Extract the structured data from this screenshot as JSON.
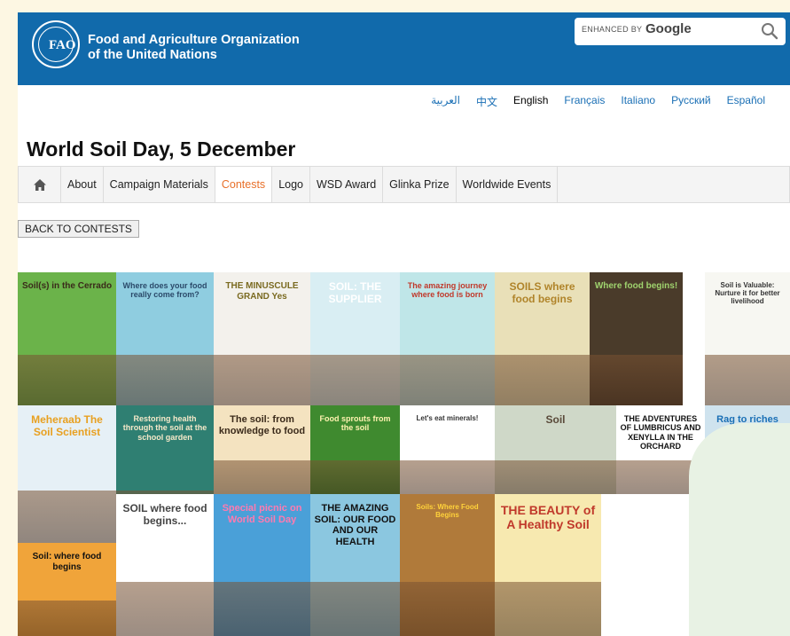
{
  "header": {
    "org_line1": "Food and Agriculture Organization",
    "org_line2": "of the United Nations",
    "logo_text": "FAO",
    "search_enhanced": "ENHANCED BY",
    "search_brand": "Google"
  },
  "languages": [
    {
      "label": "العربية",
      "active": false
    },
    {
      "label": "中文",
      "active": false
    },
    {
      "label": "English",
      "active": true
    },
    {
      "label": "Français",
      "active": false
    },
    {
      "label": "Italiano",
      "active": false
    },
    {
      "label": "Русский",
      "active": false
    },
    {
      "label": "Español",
      "active": false
    }
  ],
  "page_title": "World Soil Day, 5 December",
  "nav": {
    "items": [
      "About",
      "Campaign Materials",
      "Contests",
      "Logo",
      "WSD Award",
      "Glinka Prize",
      "Worldwide Events"
    ],
    "active": "Contests"
  },
  "back_button": "BACK TO CONTESTS",
  "covers": [
    {
      "title": "Soil(s) in the Cerrado",
      "bg": "#6bb34a",
      "fg": "#3a2a1a"
    },
    {
      "title": "Where does your food really come from?",
      "bg": "#8fcde0",
      "fg": "#2b4a6a"
    },
    {
      "title": "THE MINUSCULE GRAND Yes",
      "bg": "#f3f1ec",
      "fg": "#7a6a20"
    },
    {
      "title": "SOIL: THE SUPPLIER",
      "bg": "#d9eef3",
      "fg": "#ffffff"
    },
    {
      "title": "The amazing journey where food is born",
      "bg": "#bfe6e8",
      "fg": "#c0392b"
    },
    {
      "title": "SOILS where food begins",
      "bg": "#e9e0b8",
      "fg": "#b0842a"
    },
    {
      "title": "Where food begins!",
      "bg": "#4a3b2a",
      "fg": "#9fd36e"
    },
    {
      "title": "Soil is Valuable: Nurture it for better livelihood",
      "bg": "#f7f7f2",
      "fg": "#333333"
    },
    {
      "title": "Meheraab The Soil Scientist",
      "bg": "#e6f0f6",
      "fg": "#e8a020"
    },
    {
      "title": "Restoring health through the soil at the school garden",
      "bg": "#2f7f72",
      "fg": "#f5e9c9"
    },
    {
      "title": "The soil: from knowledge to food",
      "bg": "#f4e3c0",
      "fg": "#3a2a1a"
    },
    {
      "title": "Food sprouts from the soil",
      "bg": "#3f8a2f",
      "fg": "#fff3b0"
    },
    {
      "title": "Let's eat minerals!",
      "bg": "#ffffff",
      "fg": "#333333"
    },
    {
      "title": "Soil",
      "bg": "#cfd8c8",
      "fg": "#5a4a3a"
    },
    {
      "title": "THE ADVENTURES OF LUMBRICUS AND XENYLLA IN THE ORCHARD",
      "bg": "#ffffff",
      "fg": "#111111"
    },
    {
      "title": "Rag to riches",
      "bg": "#cfe3ee",
      "fg": "#1a6fb5"
    },
    {
      "title": "Soil: where food begins",
      "bg": "#f0a43a",
      "fg": "#111111"
    },
    {
      "title": "SOIL where food begins...",
      "bg": "#ffffff",
      "fg": "#444444"
    },
    {
      "title": "Special picnic on World Soil Day",
      "bg": "#4aa0d8",
      "fg": "#ff7ab0"
    },
    {
      "title": "THE AMAZING SOIL: OUR FOOD AND OUR HEALTH",
      "bg": "#8bc7e0",
      "fg": "#111111"
    },
    {
      "title": "Soils: Where Food Begins",
      "bg": "#b07a3a",
      "fg": "#ffd23a"
    },
    {
      "title": "THE BEAUTY of A Healthy Soil",
      "bg": "#f7e9b0",
      "fg": "#c0392b"
    }
  ],
  "colors": {
    "header_bg": "#116aab",
    "nav_active": "#e8702a",
    "link": "#1a6fb5"
  }
}
